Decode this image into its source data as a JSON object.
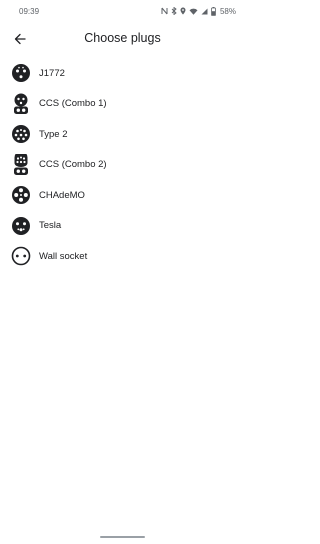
{
  "status_bar": {
    "time": "09:39",
    "battery": "58%",
    "icons": [
      "nfc-icon",
      "bluetooth-icon",
      "location-icon",
      "wifi-icon",
      "signal-icon",
      "battery-icon"
    ]
  },
  "header": {
    "title": "Choose plugs",
    "back_icon": "arrow-back-icon"
  },
  "plugs": [
    {
      "label": "J1772",
      "icon": "j1772-plug-icon"
    },
    {
      "label": "CCS (Combo 1)",
      "icon": "ccs1-plug-icon"
    },
    {
      "label": "Type 2",
      "icon": "type2-plug-icon"
    },
    {
      "label": "CCS (Combo 2)",
      "icon": "ccs2-plug-icon"
    },
    {
      "label": "CHAdeMO",
      "icon": "chademo-plug-icon"
    },
    {
      "label": "Tesla",
      "icon": "tesla-plug-icon"
    },
    {
      "label": "Wall socket",
      "icon": "wall-socket-icon"
    }
  ]
}
